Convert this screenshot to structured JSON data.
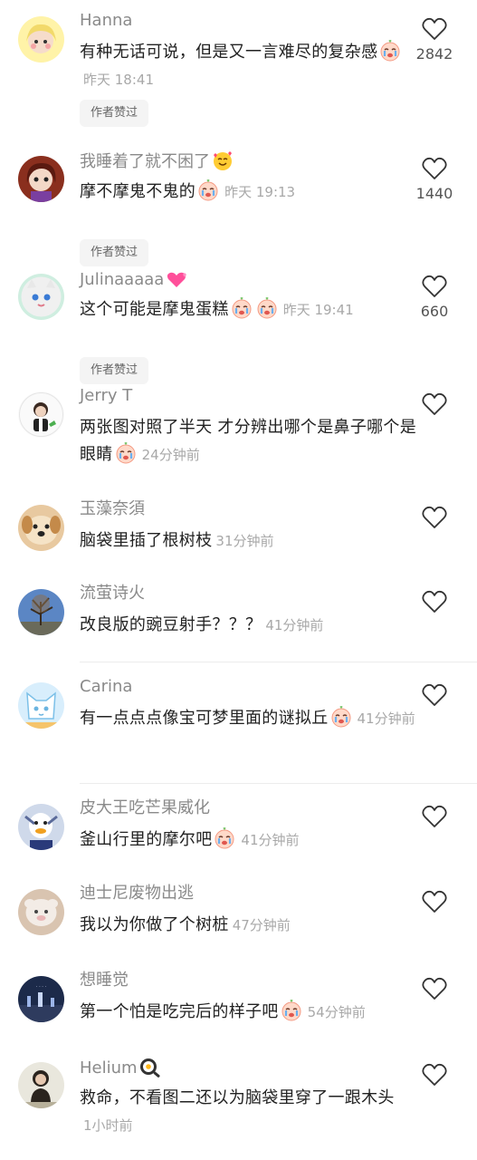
{
  "comments": [
    {
      "username": "Hanna",
      "text": "有种无话可说，但是又一言难尽的复杂感",
      "emojis_after": 1,
      "time": "昨天 18:41",
      "badge": "作者赞过",
      "likes": "2842"
    },
    {
      "username": "我睡着了就不困了",
      "username_emoji": true,
      "text": "摩不摩鬼不鬼的",
      "emojis_after": 1,
      "time": "昨天 19:13",
      "badge": "作者赞过",
      "likes": "1440"
    },
    {
      "username": "Julinaaaaa",
      "username_emoji": true,
      "text": "这个可能是摩鬼蛋糕",
      "emojis_after": 2,
      "time": "昨天 19:41",
      "badge": "作者赞过",
      "likes": "660"
    },
    {
      "username": "Jerry T",
      "text": "两张图对照了半天 才分辨出哪个是鼻子哪个是眼睛",
      "emojis_after": 1,
      "time": "24分钟前",
      "badge": "",
      "likes": ""
    },
    {
      "username": "玉藻奈須",
      "text": "脑袋里插了根树枝",
      "emojis_after": 0,
      "time": "31分钟前",
      "badge": "",
      "likes": ""
    },
    {
      "username": "流萤诗火",
      "text": "改良版的豌豆射手？？？",
      "emojis_after": 0,
      "time": "41分钟前",
      "badge": "",
      "likes": ""
    },
    {
      "username": "Carina",
      "text": "有一点点点像宝可梦里面的谜拟丘",
      "emojis_after": 1,
      "time": "41分钟前",
      "badge": "",
      "likes": ""
    },
    {
      "username": "皮大王吃芒果威化",
      "text": "釜山行里的摩尔吧",
      "emojis_after": 1,
      "time": "41分钟前",
      "badge": "",
      "likes": ""
    },
    {
      "username": "迪士尼废物出逃",
      "text": "我以为你做了个树桩",
      "emojis_after": 0,
      "time": "47分钟前",
      "badge": "",
      "likes": ""
    },
    {
      "username": "想睡觉",
      "text": "第一个怕是吃完后的样子吧",
      "emojis_after": 1,
      "time": "54分钟前",
      "badge": "",
      "likes": ""
    },
    {
      "username": "Helium",
      "username_emoji": true,
      "text": "救命，不看图二还以为脑袋里穿了一跟木头",
      "emojis_after": 0,
      "time": "1小时前",
      "badge": "",
      "likes": ""
    }
  ],
  "colors": {
    "text": "#222222",
    "username": "#8a8a8a",
    "time": "#a8a8a8",
    "badge_bg": "#f4f4f4"
  }
}
